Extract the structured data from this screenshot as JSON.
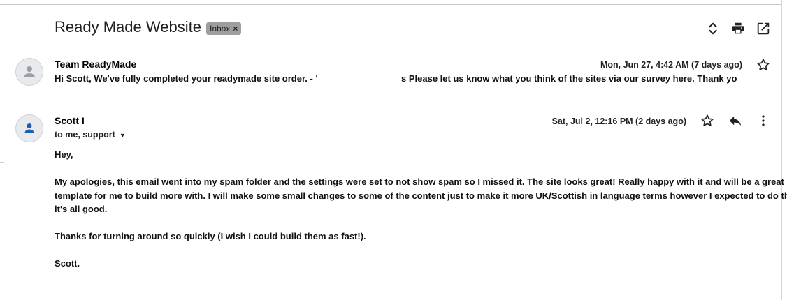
{
  "thread": {
    "subject": "Ready Made Website",
    "label": "Inbox",
    "label_remove": "×"
  },
  "toolbar": {
    "icons": [
      "expand-collapse-icon",
      "print-icon",
      "open-new-window-icon"
    ]
  },
  "messages": [
    {
      "sender": "Team ReadyMade",
      "date": "Mon, Jun 27, 4:42 AM (7 days ago)",
      "snippet_start": "Hi Scott, We've fully completed your readymade site order. - '",
      "snippet_end": "s Please let us know what you think of the sites via our survey here. Thank yo"
    },
    {
      "sender": "Scott I",
      "date": "Sat, Jul 2, 12:16 PM (2 days ago)",
      "recipients": "to me, support",
      "body": {
        "greeting": "Hey,",
        "p1_line1": "My apologies, this email went into my spam folder and the settings were set to not show spam so I missed it.  The site looks great!  Really happy with it and will be a great",
        "p1_line2": "template for me to build more with.  I will make some small changes to some of the content just to make it more UK/Scottish in language terms however I expected to do that so",
        "p1_line3": "it's all good.",
        "p2": "Thanks for turning around so quickly (I wish I could build them as fast!).",
        "signoff": "Scott."
      }
    }
  ],
  "colors": {
    "chip_bg": "#9e9e9e",
    "avatar_bg": "#e8eaed",
    "avatar_grey": "#9aa0a6",
    "avatar_blue": "#1a5fb4"
  }
}
